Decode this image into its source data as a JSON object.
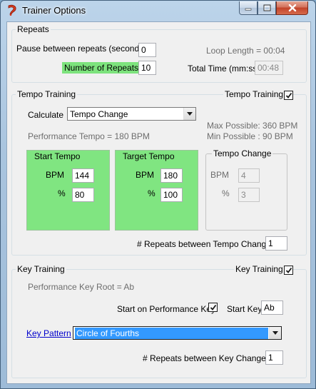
{
  "window": {
    "title": "Trainer Options",
    "accent_color": "#7de37d"
  },
  "repeats": {
    "group_title": "Repeats",
    "pause_label": "Pause between repeats (seconds)",
    "pause_value": "0",
    "number_label": "Number of Repeats",
    "number_value": "10",
    "loop_length": "Loop Length = 00:04",
    "total_time_label": "Total Time (mm:ss)",
    "total_time_value": "00:48"
  },
  "tempo": {
    "group_title": "Tempo Training",
    "enable_label": "Tempo Training",
    "enabled": true,
    "calculate_label": "Calculate",
    "calculate_value": "Tempo Change",
    "max_possible": "Max Possible: 360 BPM",
    "min_possible": "Min Possible : 90 BPM",
    "performance_tempo": "Performance Tempo = 180 BPM",
    "start": {
      "title": "Start Tempo",
      "bpm_label": "BPM",
      "bpm": "144",
      "pct_label": "%",
      "pct": "80"
    },
    "target": {
      "title": "Target Tempo",
      "bpm_label": "BPM",
      "bpm": "180",
      "pct_label": "%",
      "pct": "100"
    },
    "change": {
      "title": "Tempo Change",
      "bpm_label": "BPM",
      "bpm": "4",
      "pct_label": "%",
      "pct": "3"
    },
    "repeats_label": "# Repeats between Tempo Changes",
    "repeats_value": "1"
  },
  "key": {
    "group_title": "Key Training",
    "enable_label": "Key Training",
    "enabled": true,
    "root": "Performance Key Root = Ab",
    "start_on_perf_label": "Start on Performance Key",
    "start_on_perf": true,
    "start_key_label": "Start Key",
    "start_key_value": "Ab",
    "pattern_label": "Key Pattern",
    "pattern_value": "Circle of Fourths",
    "repeats_label": "# Repeats between Key Changes",
    "repeats_value": "1"
  }
}
